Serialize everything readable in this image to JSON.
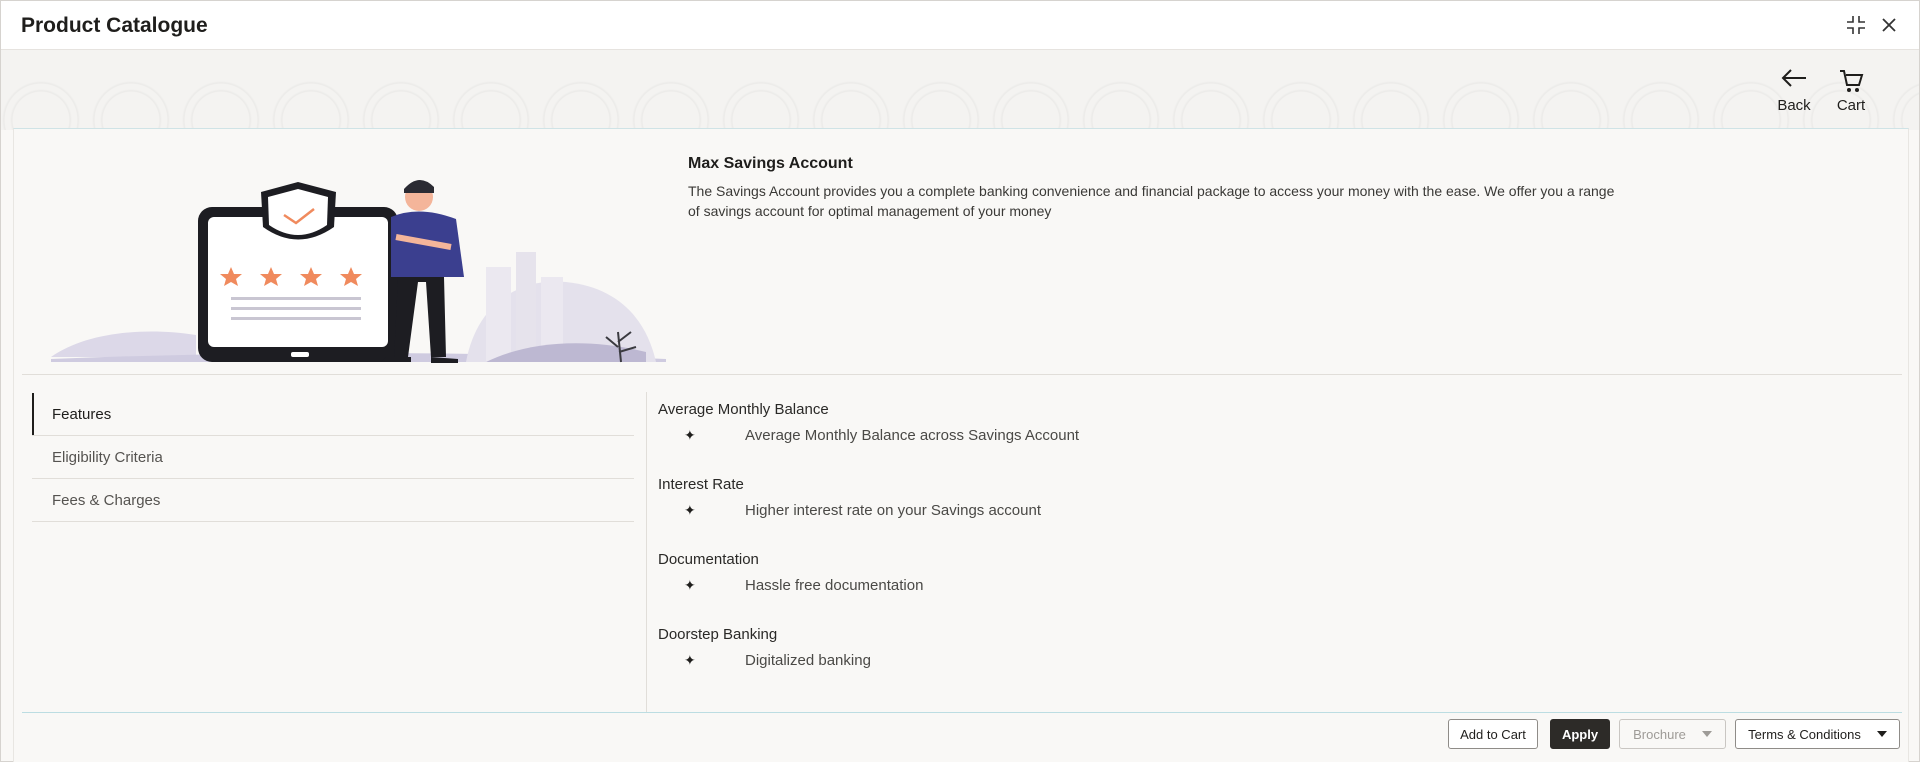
{
  "window": {
    "title": "Product Catalogue"
  },
  "titlebar_icons": {
    "minimize": "collapse-icon",
    "close": "close-icon"
  },
  "nav": {
    "back_label": "Back",
    "cart_label": "Cart"
  },
  "product": {
    "name": "Max Savings Account",
    "description": "The Savings Account provides you a complete banking convenience and financial package to access your money with the ease. We offer you a range of savings account for optimal management of your money"
  },
  "tabs": [
    {
      "label": "Features",
      "active": true
    },
    {
      "label": "Eligibility Criteria",
      "active": false
    },
    {
      "label": "Fees & Charges",
      "active": false
    }
  ],
  "features": [
    {
      "heading": "Average Monthly Balance",
      "detail": "Average Monthly Balance across Savings Account"
    },
    {
      "heading": "Interest Rate",
      "detail": "Higher interest rate on your Savings account"
    },
    {
      "heading": "Documentation",
      "detail": "Hassle free documentation"
    },
    {
      "heading": "Doorstep Banking",
      "detail": "Digitalized banking"
    }
  ],
  "footer": {
    "add_to_cart": "Add to Cart",
    "apply": "Apply",
    "brochure": "Brochure",
    "terms": "Terms & Conditions"
  },
  "colors": {
    "accent_dark": "#2d2b28",
    "divider_teal": "#bcdde2",
    "figure_blue": "#3b3f8f",
    "star_orange": "#f08a5d"
  }
}
